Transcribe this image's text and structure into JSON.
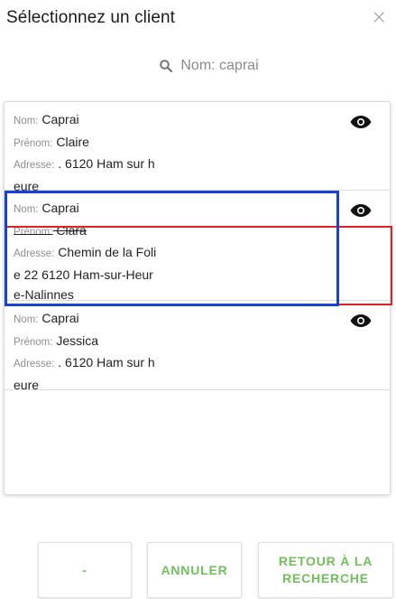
{
  "dialog": {
    "title": "Sélectionnez un client",
    "close_label": "×"
  },
  "search": {
    "text": "Nom: caprai",
    "icon": "search-icon"
  },
  "clients": [
    {
      "nom_label": "Nom:",
      "nom": "Caprai",
      "prenom_label": "Prénom:",
      "prenom": "Claire",
      "adresse_label": "Adresse:",
      "adresse_1": ". 6120 Ham sur h",
      "adresse_2": "eure"
    },
    {
      "nom_label": "Nom:",
      "nom": "Caprai",
      "prenom_label": "Prénom:",
      "prenom": "Clara",
      "adresse_label": "Adresse:",
      "adresse_1": "Chemin de la Foli",
      "adresse_2": "e 22 6120 Ham-sur-Heur",
      "adresse_3": "e-Nalinnes"
    },
    {
      "nom_label": "Nom:",
      "nom": "Caprai",
      "prenom_label": "Prénom:",
      "prenom": "Jessica",
      "adresse_label": "Adresse:",
      "adresse_1": ". 6120 Ham sur h",
      "adresse_2": "eure"
    }
  ],
  "buttons": {
    "dash": "-",
    "cancel": "ANNULER",
    "back_1": "RETOUR À LA",
    "back_2": "RECHERCHE"
  },
  "colors": {
    "accent_green": "#6fbf5b",
    "highlight_blue": "#1a41d6",
    "highlight_red": "#e0202a"
  }
}
